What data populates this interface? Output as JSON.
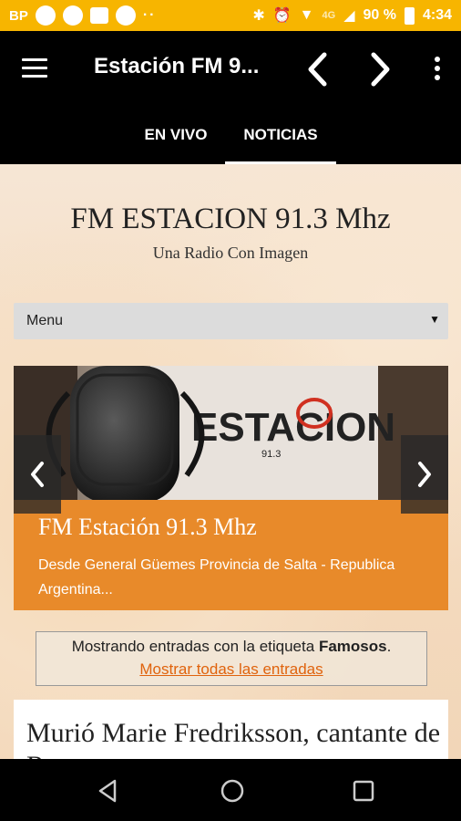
{
  "status_bar": {
    "left_text": "BP",
    "dots": "··",
    "network": "4G",
    "battery": "90 %",
    "time": "4:34"
  },
  "app_bar": {
    "title": "Estación FM 9..."
  },
  "tabs": [
    {
      "label": "EN VIVO",
      "selected": false
    },
    {
      "label": "NOTICIAS",
      "selected": true
    }
  ],
  "page": {
    "site_title": "FM ESTACION 91.3 Mhz",
    "site_subtitle": "Una Radio Con Imagen",
    "menu": {
      "selected": "Menu"
    },
    "slider": {
      "title": "FM Estación 91.3 Mhz",
      "description": "Desde General Güemes Provincia de Salta - Republica Argentina...",
      "image_text": "ESTACION",
      "image_subtext": "91.3"
    },
    "label_notice": {
      "prefix": "Mostrando entradas con la etiqueta",
      "tag": "Famosos",
      "suffix": ".",
      "link": "Mostrar todas las entradas"
    },
    "post": {
      "title": "Murió Marie Fredriksson, cantante de Roxette"
    }
  },
  "colors": {
    "status_bar": "#f7b500",
    "caption": "#e88a2a",
    "link": "#e0630d"
  }
}
